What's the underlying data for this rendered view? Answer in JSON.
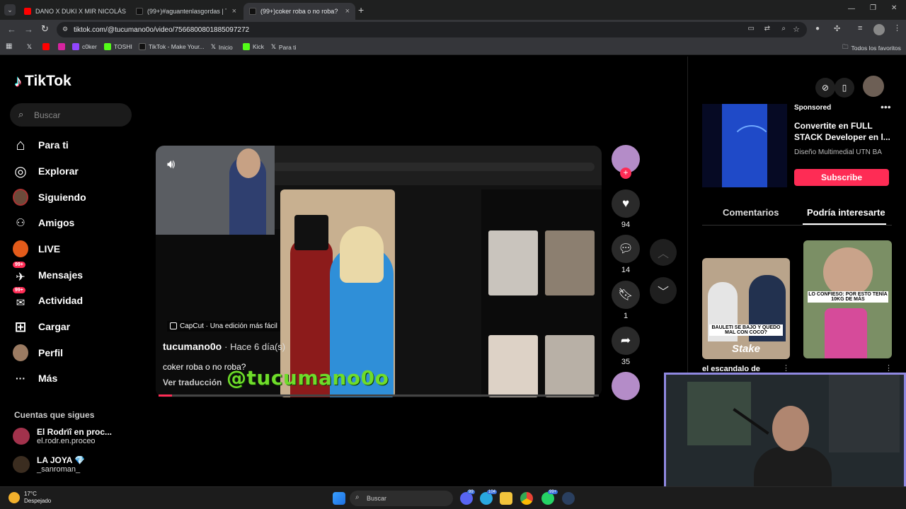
{
  "browser": {
    "tabs": [
      {
        "label": "DANO X DUKI X MIR NICOLÁS",
        "active": false
      },
      {
        "label": "(99+)#aguantenlasgordas | TikTok",
        "active": false
      },
      {
        "label": "(99+)coker roba o no roba? | c",
        "active": true
      }
    ],
    "new_tab": "+",
    "url": "tiktok.com/@tucumano0o/video/7566800801885097272",
    "bookmarks": [
      "c0ker",
      "TOSHI",
      "TikTok - Make Your...",
      "Inicio",
      "Kick",
      "Para ti"
    ],
    "all_bookmarks": "Todos los favoritos",
    "window_controls": {
      "minimize": "—",
      "restore": "❐",
      "close": "✕"
    }
  },
  "sidebar": {
    "logo_text": "TikTok",
    "search_placeholder": "Buscar",
    "items": [
      {
        "label": "Para ti",
        "icon": "home-icon",
        "glyph": "⌂"
      },
      {
        "label": "Explorar",
        "icon": "compass-icon",
        "glyph": "◎"
      },
      {
        "label": "Siguiendo",
        "icon": "following-avatar-icon",
        "glyph": ""
      },
      {
        "label": "Amigos",
        "icon": "friends-icon",
        "glyph": "👥"
      },
      {
        "label": "LIVE",
        "icon": "live-icon",
        "glyph": ""
      },
      {
        "label": "Mensajes",
        "icon": "messages-icon",
        "glyph": "✈",
        "badge": "99+"
      },
      {
        "label": "Actividad",
        "icon": "activity-icon",
        "glyph": "✉",
        "badge": "99+"
      },
      {
        "label": "Cargar",
        "icon": "upload-icon",
        "glyph": "⊞"
      },
      {
        "label": "Perfil",
        "icon": "profile-avatar-icon",
        "glyph": ""
      },
      {
        "label": "Más",
        "icon": "more-icon",
        "glyph": "···"
      }
    ],
    "following_title": "Cuentas que sigues",
    "following": [
      {
        "name": "El Rodrïî en proc...",
        "handle": "el.rodr.en.proceo"
      },
      {
        "name": "LA JOYA 💎",
        "handle": "_sanroman_"
      }
    ]
  },
  "video": {
    "capcut_label": "CapCut · Una edición más fácil",
    "author": "tucumano0o",
    "posted": "· Hace 6 día(s)",
    "caption": "coker roba o no roba?",
    "translate": "Ver traducción",
    "watermark": "@tucumano0o",
    "progress": 0.03
  },
  "actions": {
    "likes": "94",
    "comments": "14",
    "saves": "1",
    "shares": "35"
  },
  "right_panel": {
    "sponsored": "Sponsored",
    "ad_title": "Convertite en FULL STACK Developer en l...",
    "ad_brand": "Diseño Multimedial UTN BA",
    "subscribe": "Subscribe",
    "tabs": [
      "Comentarios",
      "Podría interesarte"
    ],
    "card1_caption": "BAULETI SE BAJO Y QUEDO MAL CON COCO?",
    "card1_brand": "Stake",
    "card1_title": "el escandalo de",
    "card2_caption": "LO CONFIESO: POR ESTO TENÍA 10KG DE MÁS"
  },
  "taskbar": {
    "temp": "17°C",
    "weather": "Despejado",
    "search": "Buscar",
    "badges": [
      "99",
      "104",
      "99+"
    ]
  },
  "colors": {
    "accent": "#fe2c55",
    "watermark": "#6fdc2a",
    "webcam_border": "#8f88e0"
  }
}
